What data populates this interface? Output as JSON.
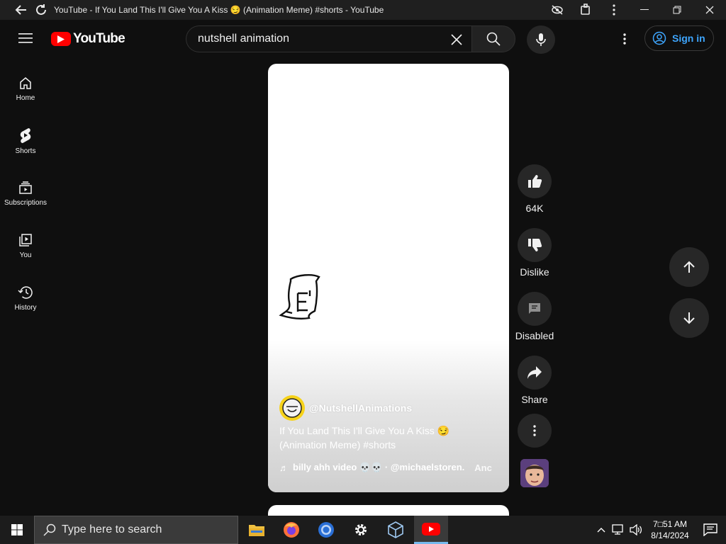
{
  "window": {
    "title": "YouTube - If You Land This I'll Give You A Kiss 😏 (Animation Meme) #shorts - YouTube"
  },
  "header": {
    "logo_text": "YouTube",
    "search_value": "nutshell animation",
    "signin_label": "Sign in"
  },
  "sidebar": {
    "items": [
      {
        "label": "Home",
        "icon": "home-icon"
      },
      {
        "label": "Shorts",
        "icon": "shorts-icon"
      },
      {
        "label": "Subscriptions",
        "icon": "subscriptions-icon"
      },
      {
        "label": "You",
        "icon": "you-icon"
      },
      {
        "label": "History",
        "icon": "history-icon"
      }
    ]
  },
  "video": {
    "channel": "@NutshellAnimations",
    "title": "If You Land This I'll Give You A Kiss 😏 (Animation Meme) #shorts",
    "music_text": "billy ahh video 💀💀 · @michaelstoren.",
    "music_overflow": "Anc"
  },
  "actions": {
    "like_count": "64K",
    "dislike_label": "Dislike",
    "comments_label": "Disabled",
    "share_label": "Share"
  },
  "taskbar": {
    "search_placeholder": "Type here to search",
    "time": "7□51 AM",
    "date": "8/14/2024"
  },
  "colors": {
    "accent_link": "#3ea6ff",
    "brand_red": "#ff0000",
    "background": "#0f0f0f"
  }
}
